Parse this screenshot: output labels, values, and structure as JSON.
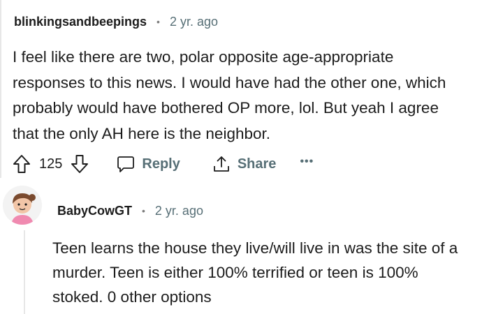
{
  "comment": {
    "username": "blinkingsandbeepings",
    "separator": "•",
    "time": "2 yr. ago",
    "lines": [
      "I feel like there are two, polar opposite age-appropriate",
      "responses to this news. I would have had the other one, which",
      "probably would have bothered OP more, lol. But yeah I agree",
      "that the only AH here is the neighbor."
    ],
    "score": "125",
    "reply_label": "Reply",
    "share_label": "Share",
    "more_label": "•••"
  },
  "reply": {
    "username": "BabyCowGT",
    "separator": "•",
    "time": "2 yr. ago",
    "lines": [
      "Teen learns the house they live/will live in was the site of a",
      "murder. Teen is either 100% terrified or teen is 100%",
      "stoked. 0 other options"
    ]
  },
  "colors": {
    "text": "#1c1c1c",
    "muted": "#576f76",
    "thread_line": "#e7e7e7",
    "avatar_skin": "#f2c6a8",
    "avatar_hair": "#7a4a2e",
    "avatar_shirt": "#f08ab0"
  }
}
